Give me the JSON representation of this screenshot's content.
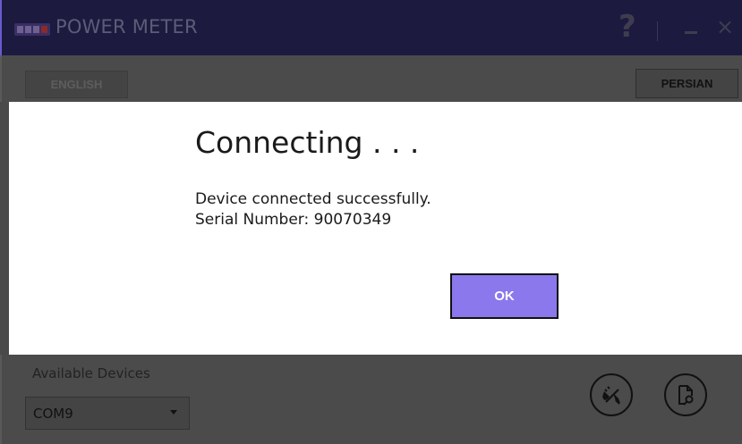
{
  "window": {
    "title": "POWER METER",
    "help_icon": "?",
    "minimize_icon": "–",
    "close_icon": "×"
  },
  "language": {
    "english_label": "ENGLISH",
    "persian_label": "PERSIAN"
  },
  "dialog": {
    "title": "Connecting . . .",
    "message_line1": "Device connected successfully.",
    "message_line2": "Serial Number: 90070349",
    "ok_label": "OK"
  },
  "devices": {
    "label": "Available Devices",
    "selected": "COM9"
  },
  "icons": {
    "logo": "app-logo",
    "help": "help-icon",
    "minimize": "minimize-icon",
    "close": "close-icon",
    "dropdown": "chevron-down-icon",
    "disconnect": "unplug-icon",
    "report": "document-search-icon"
  },
  "colors": {
    "accent": "#8a78ec",
    "titlebar": "#1c1a3f"
  }
}
